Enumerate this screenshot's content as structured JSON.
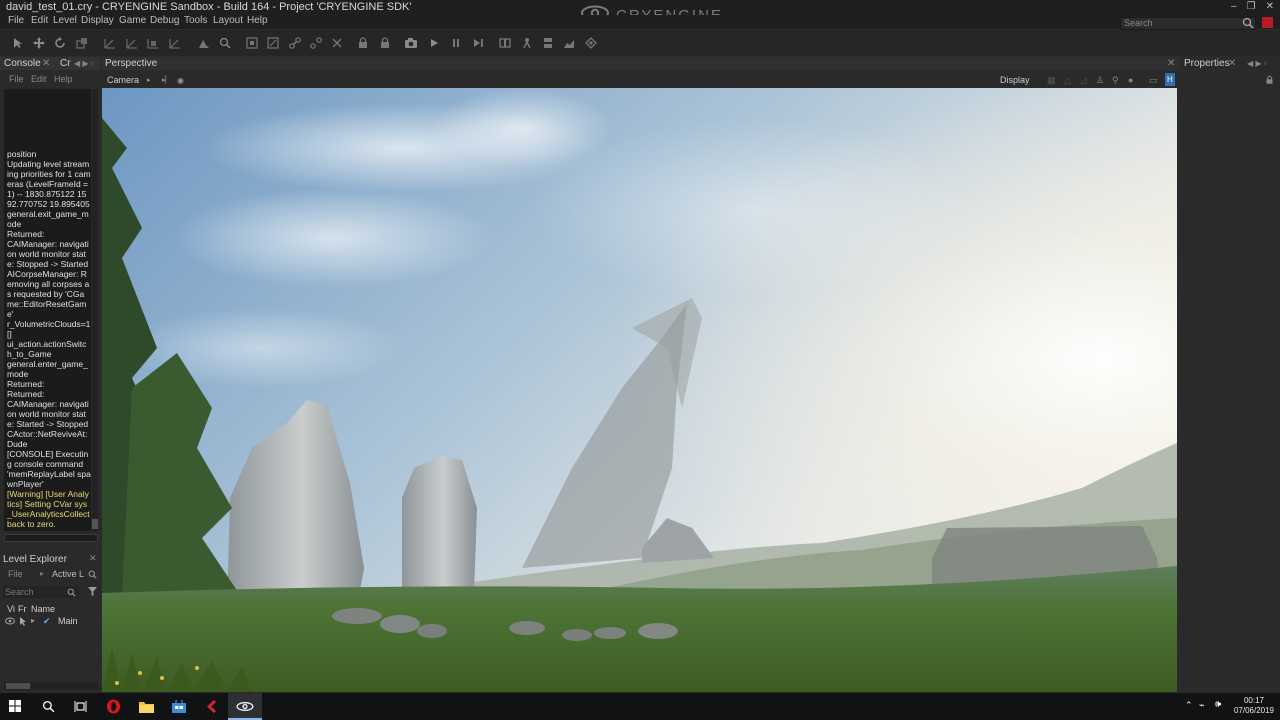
{
  "window": {
    "title": "david_test_01.cry - CRYENGINE Sandbox - Build 164 - Project 'CRYENGINE SDK'",
    "brand": "CRYENGINE",
    "controls": [
      "–",
      "❐",
      "✕"
    ]
  },
  "menubar": {
    "items": [
      "File",
      "Edit",
      "Level",
      "Display",
      "Game",
      "Debug",
      "Tools",
      "Layout",
      "Help"
    ],
    "search_placeholder": "Search"
  },
  "console": {
    "tab_label": "Console",
    "tab2_label": "Cr",
    "menu": [
      "File",
      "Edit",
      "Help"
    ],
    "lines": [
      {
        "text": "position",
        "warn": false
      },
      {
        "text": "Updating level streaming priorities for 1 cameras (LevelFrameId = 1) -- 1830.875122 1592.770752 19.895405",
        "warn": false
      },
      {
        "text": "general.exit_game_mode",
        "warn": false
      },
      {
        "text": "Returned:",
        "warn": false
      },
      {
        "text": "CAIManager: navigation world monitor state: Stopped -> Started",
        "warn": false
      },
      {
        "text": "AICorpseManager: Removing all corpses as requested by 'CGame::EditorResetGame'",
        "warn": false
      },
      {
        "text": "r_VolumetricClouds=1 []",
        "warn": false
      },
      {
        "text": "ui_action.actionSwitch_to_Game",
        "warn": false
      },
      {
        "text": "general.enter_game_mode",
        "warn": false
      },
      {
        "text": "Returned:",
        "warn": false
      },
      {
        "text": "Returned:",
        "warn": false
      },
      {
        "text": "CAIManager: navigation world monitor state: Started -> Stopped",
        "warn": false
      },
      {
        "text": "CActor::NetReviveAt: Dude",
        "warn": false
      },
      {
        "text": "[CONSOLE] Executing console command 'memReplayLabel spawnPlayer'",
        "warn": false
      },
      {
        "text": "[Warning] [User Analytics] Setting CVar sys_UserAnalyticsCollect back to zero.",
        "warn": true
      }
    ]
  },
  "level_explorer": {
    "title": "Level Explorer",
    "file_label": "File",
    "active_label": "Active L:",
    "search_placeholder": "Search",
    "columns": [
      "Vi",
      "Fr",
      "Name"
    ],
    "rows": [
      {
        "name": "Main"
      }
    ]
  },
  "perspective": {
    "tab_label": "Perspective",
    "camera_label": "Camera",
    "display_label": "Display"
  },
  "properties": {
    "tab_label": "Properties"
  },
  "taskbar": {
    "time": "00:17",
    "date": "07/06/2019",
    "accent": "#8bb8e8"
  },
  "colors": {
    "notify_red": "#b81c24",
    "warning_text": "#e7da72"
  }
}
